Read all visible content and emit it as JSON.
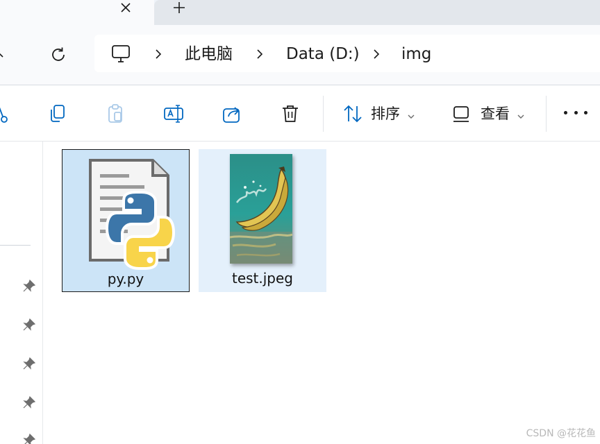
{
  "breadcrumb": [
    {
      "label": "此电脑"
    },
    {
      "label": "Data (D:)"
    },
    {
      "label": "img"
    }
  ],
  "commandbar": {
    "sort_label": "排序",
    "view_label": "查看"
  },
  "files": [
    {
      "name": "py.py",
      "icon": "python-file-icon",
      "selected": true
    },
    {
      "name": "test.jpeg",
      "icon": "banana-image-thumbnail",
      "selected": false
    }
  ],
  "watermark": "CSDN @花花鱼",
  "colors": {
    "selection": "#cce4f7",
    "hover": "#e4f0fb",
    "accent": "#0067c0"
  }
}
